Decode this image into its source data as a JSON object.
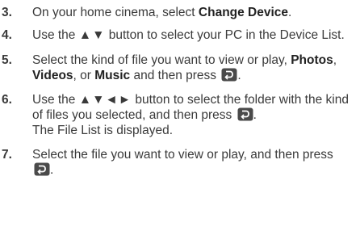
{
  "steps": [
    {
      "number": "3.",
      "before": "On your home cinema, select ",
      "bold": "Change Device",
      "after": "."
    },
    {
      "number": "4.",
      "text_a": "Use the ",
      "arrows": "▲▼",
      "text_b": " button to select your PC in the Device List."
    },
    {
      "number": "5.",
      "text_a": "Select the kind of file you want to view or play, ",
      "bold_1": "Photos",
      "sep_1": ", ",
      "bold_2": "Videos",
      "sep_2": ", or ",
      "bold_3": "Music",
      "text_b": " and then press ",
      "icon": "enter-button-icon",
      "end": "."
    },
    {
      "number": "6.",
      "text_a": "Use the ",
      "arrows": "▲▼◄►",
      "text_b": " button to select the folder with the kind of files you selected, and then press ",
      "icon": "enter-button-icon",
      "end": ".",
      "text_c": "The File List is displayed."
    },
    {
      "number": "7.",
      "text_a": "Select the file you want to view or play, and then press ",
      "icon": "enter-button-icon",
      "end": "."
    }
  ],
  "colors": {
    "text": "#3a3a3a",
    "icon_fill": "#4a4a4a"
  }
}
